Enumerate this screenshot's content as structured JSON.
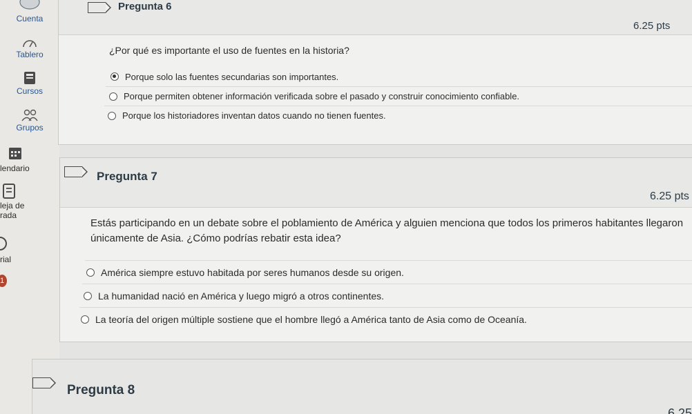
{
  "sidebar": {
    "items": [
      {
        "label": "Cuenta",
        "icon": "account-icon"
      },
      {
        "label": "Tablero",
        "icon": "dashboard-icon"
      },
      {
        "label": "Cursos",
        "icon": "courses-icon"
      },
      {
        "label": "Grupos",
        "icon": "groups-icon"
      },
      {
        "label": "lendario",
        "icon": "calendar-icon"
      },
      {
        "label": "leja de",
        "icon": "inbox-icon"
      },
      {
        "label": "rada",
        "icon": ""
      },
      {
        "label": "rial",
        "icon": "history-icon"
      }
    ],
    "badge": "1"
  },
  "questions": [
    {
      "title": "Pregunta 6",
      "points": "6.25 pts",
      "text": "¿Por qué es importante el uso de fuentes en la historia?",
      "answers": [
        {
          "label": "Porque solo las fuentes secundarias son importantes.",
          "selected": true
        },
        {
          "label": "Porque permiten obtener información verificada sobre el pasado y construir conocimiento confiable.",
          "selected": false
        },
        {
          "label": "Porque los historiadores inventan datos cuando no tienen fuentes.",
          "selected": false
        }
      ]
    },
    {
      "title": "Pregunta 7",
      "points": "6.25 pts",
      "text_line1": "Estás participando en un debate sobre el poblamiento de América y alguien menciona que todos los primeros habitantes llegaron",
      "text_line2": "únicamente de Asia. ¿Cómo podrías rebatir esta idea?",
      "answers": [
        {
          "label": "América siempre estuvo habitada por seres humanos desde su origen.",
          "selected": false
        },
        {
          "label": "La humanidad nació en América y luego migró a otros continentes.",
          "selected": false
        },
        {
          "label": "La teoría del origen múltiple sostiene que el hombre llegó a América tanto de Asia como de Oceanía.",
          "selected": false
        }
      ]
    },
    {
      "title": "Pregunta 8",
      "points": "6.25"
    }
  ]
}
